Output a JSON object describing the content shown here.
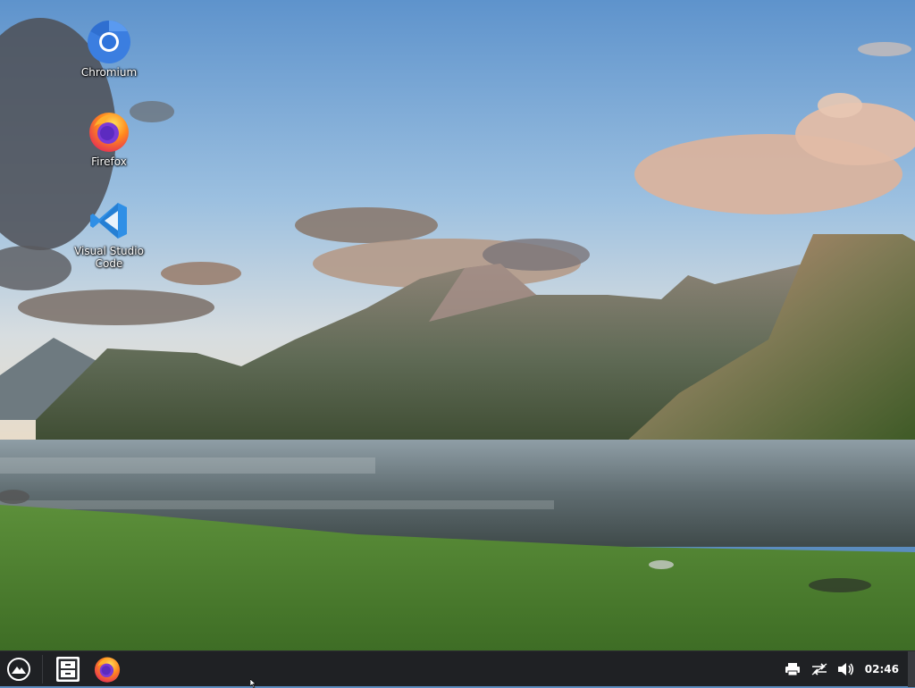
{
  "desktop": {
    "icons": [
      {
        "label": "Chromium",
        "icon": "chromium-icon"
      },
      {
        "label": "Firefox",
        "icon": "firefox-icon"
      },
      {
        "label": "Visual Studio Code",
        "icon": "vscode-icon"
      }
    ]
  },
  "taskbar": {
    "launcher_icon": "app-launcher-icon",
    "pinned": [
      {
        "icon": "file-manager-icon"
      },
      {
        "icon": "firefox-icon"
      }
    ],
    "tray": [
      {
        "icon": "printer-icon"
      },
      {
        "icon": "network-icon"
      },
      {
        "icon": "volume-icon"
      }
    ],
    "clock": "02:46"
  },
  "colors": {
    "taskbar_bg": "#1f2124",
    "vscode_blue": "#2f8fe6",
    "chromium_blue": "#3b7ee0",
    "firefox_orange": "#ff7a18"
  }
}
